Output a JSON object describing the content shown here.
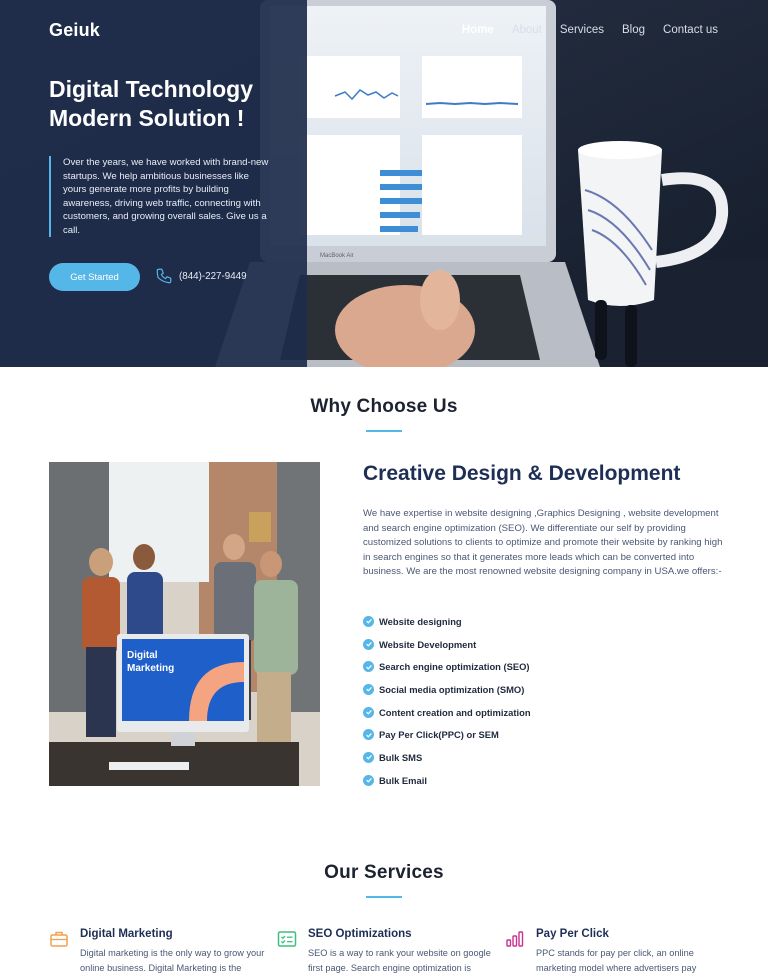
{
  "header": {
    "brand": "Geiuk",
    "nav": [
      {
        "label": "Home",
        "active": true
      },
      {
        "label": "About",
        "active": false
      },
      {
        "label": "Services",
        "active": false
      },
      {
        "label": "Blog",
        "active": false
      },
      {
        "label": "Contact us",
        "active": false
      }
    ]
  },
  "hero": {
    "title_line1": "Digital Technology",
    "title_line2": "Modern Solution !",
    "text": "Over the years, we have worked with brand-new startups. We help ambitious businesses like yours generate more profits by building awareness, driving web traffic, connecting with customers, and growing overall sales. Give us a call.",
    "cta_label": "Get Started",
    "phone": "(844)-227-9449",
    "laptop_label": "MacBook Air",
    "photo_alt": "Laptop with analytics dashboard and a coffee mug"
  },
  "why": {
    "title": "Why Choose Us",
    "heading": "Creative Design & Development",
    "text": "We have expertise in website designing ,Graphics Designing , website development and search engine optimization (SEO). We differentiate our self by providing customized solutions to clients to optimize and promote their website by ranking high in search engines so that it generates more leads which can be converted into business. We are the most renowned website designing company in USA.we offers:-",
    "items": [
      "Website designing",
      "Website Development",
      "Search engine optimization (SEO)",
      "Social media optimization (SMO)",
      "Content creation and optimization",
      "Pay Per Click(PPC) or SEM",
      "Bulk SMS",
      "Bulk Email"
    ],
    "monitor_text": "Digital Marketing"
  },
  "services": {
    "title": "Our Services",
    "items": [
      {
        "title": "Digital Marketing",
        "text": "Digital marketing is the only way to grow your online business. Digital Marketing is the",
        "icon": "briefcase-icon"
      },
      {
        "title": "SEO Optimizations",
        "text": "SEO is a way to rank your website on google first page. Search engine optimization is",
        "icon": "checklist-icon"
      },
      {
        "title": "Pay Per Click",
        "text": "PPC stands for pay per click, an online marketing model where advertisers pay",
        "icon": "bar-chart-icon"
      }
    ]
  },
  "colors": {
    "accent": "#55b6e8",
    "hero_overlay": "#1e2d4b",
    "heading_navy": "#1e2e55",
    "icon_orange": "#f0a050",
    "icon_green": "#3fbf7f",
    "icon_pink": "#c8348f"
  }
}
